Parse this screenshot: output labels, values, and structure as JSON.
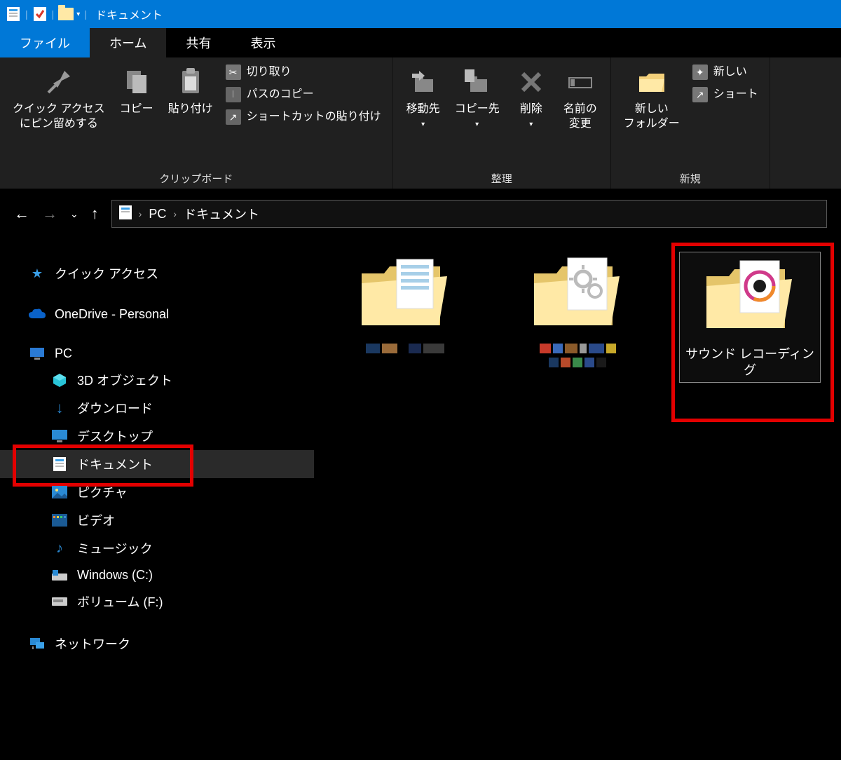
{
  "title": "ドキュメント",
  "tabs": {
    "file": "ファイル",
    "home": "ホーム",
    "share": "共有",
    "view": "表示"
  },
  "ribbon": {
    "pin_quick_access": "クイック アクセス\nにピン留めする",
    "copy": "コピー",
    "paste": "貼り付け",
    "cut": "切り取り",
    "copy_path": "パスのコピー",
    "paste_shortcut": "ショートカットの貼り付け",
    "clipboard_group": "クリップボード",
    "move_to": "移動先",
    "copy_to": "コピー先",
    "delete": "削除",
    "rename": "名前の\n変更",
    "organize_group": "整理",
    "new_folder": "新しい\nフォルダー",
    "new_item": "新しい",
    "shortcut_item": "ショート",
    "new_group": "新規"
  },
  "breadcrumb": {
    "pc": "PC",
    "documents": "ドキュメント"
  },
  "sidebar": {
    "quick_access": "クイック アクセス",
    "onedrive": "OneDrive - Personal",
    "pc": "PC",
    "objects3d": "3D オブジェクト",
    "downloads": "ダウンロード",
    "desktop": "デスクトップ",
    "documents": "ドキュメント",
    "pictures": "ピクチャ",
    "videos": "ビデオ",
    "music": "ミュージック",
    "windows_c": "Windows (C:)",
    "volume_f": "ボリューム (F:)",
    "network": "ネットワーク"
  },
  "content_items": {
    "sound_recording": "サウンド レコーディング"
  }
}
